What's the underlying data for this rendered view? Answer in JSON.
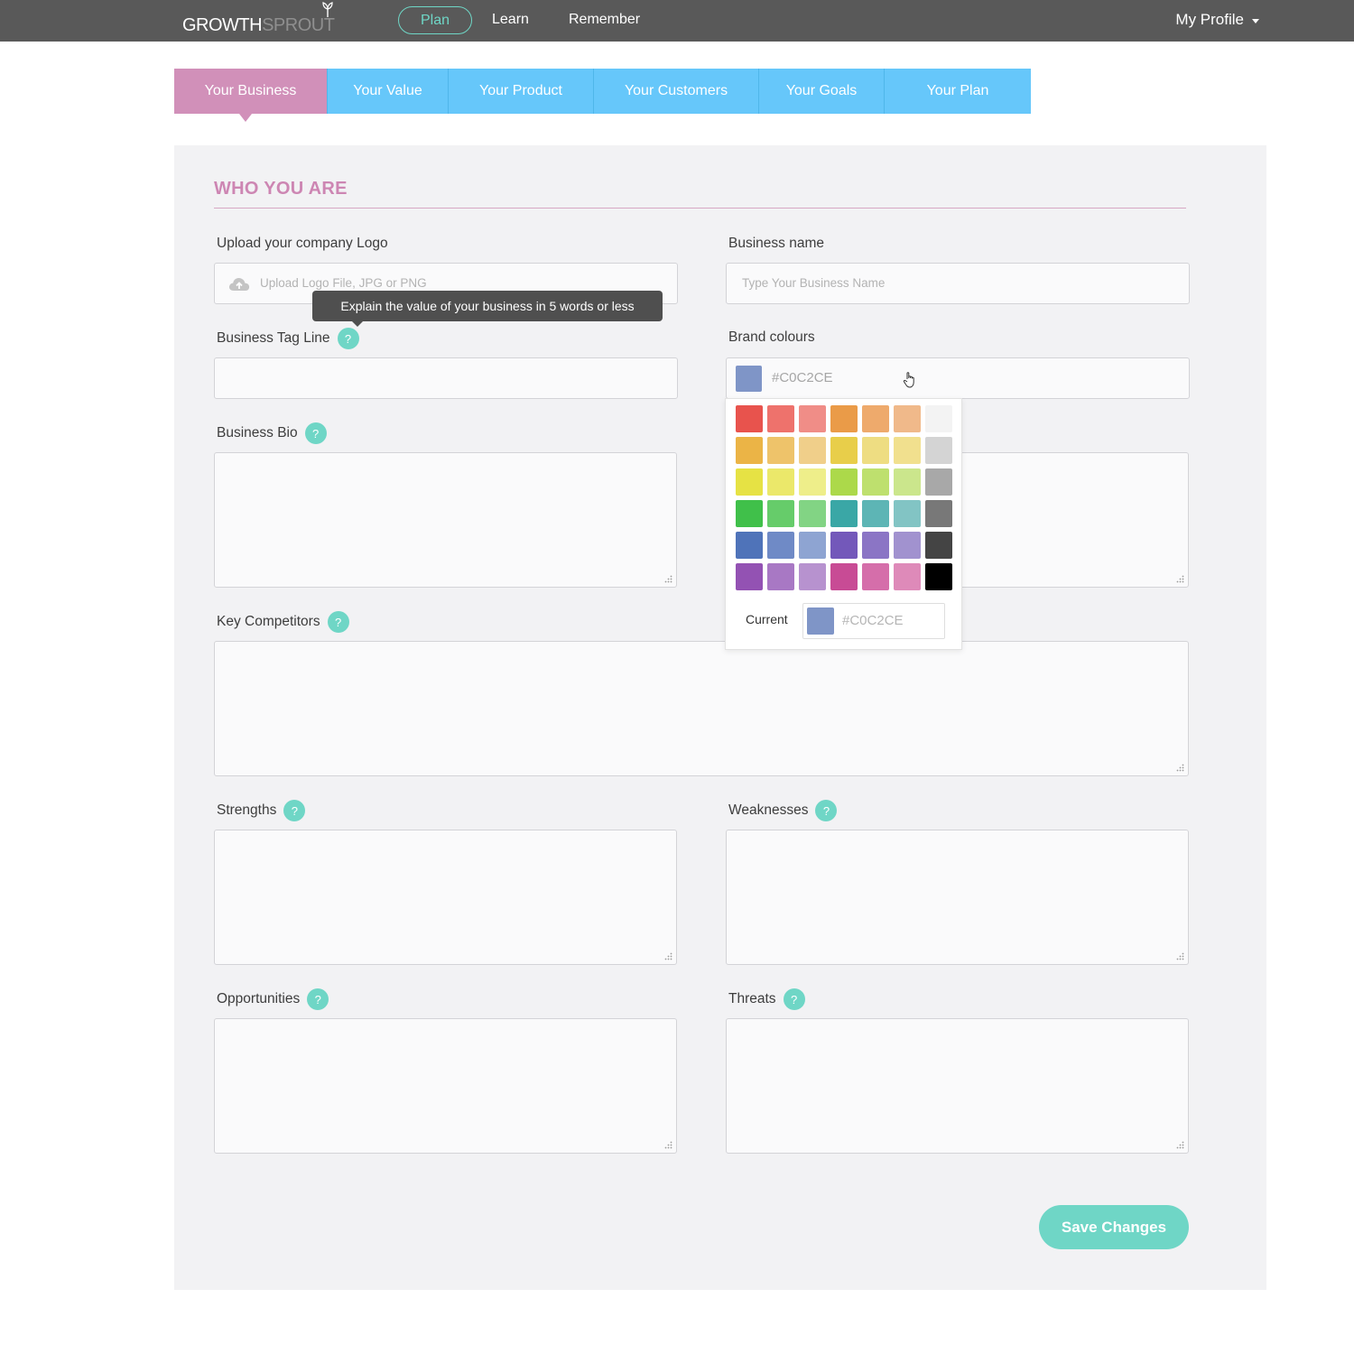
{
  "nav": {
    "logo_growth": "GROWTH",
    "logo_sprout": "SPROUT",
    "plan": "Plan",
    "learn": "Learn",
    "remember": "Remember",
    "profile": "My Profile",
    "accent_color": "#6fd6c6",
    "bar_color": "#595959"
  },
  "tabs": [
    {
      "label": "Your Business",
      "active": true
    },
    {
      "label": "Your Value",
      "active": false
    },
    {
      "label": "Your Product",
      "active": false
    },
    {
      "label": "Your Customers",
      "active": false
    },
    {
      "label": "Your Goals",
      "active": false
    },
    {
      "label": "Your Plan",
      "active": false
    }
  ],
  "tab_colors": {
    "active": "#d190b9",
    "inactive": "#66c7fa"
  },
  "section": {
    "title": "WHO YOU ARE",
    "color": "#cd86b3"
  },
  "fields": {
    "logo": {
      "label": "Upload your company Logo",
      "placeholder": "Upload Logo File, JPG or PNG",
      "icon": "cloud-upload-icon"
    },
    "business_name": {
      "label": "Business name",
      "placeholder": "Type Your Business Name"
    },
    "tag_line": {
      "label": "Business Tag Line",
      "value": ""
    },
    "brand_colours": {
      "label": "Brand colours",
      "value": "#C0C2CE",
      "swatch": "#7f95c7"
    },
    "bio": {
      "label": "Business Bio"
    },
    "competitors": {
      "label": "Key Competitors"
    },
    "strengths": {
      "label": "Strengths"
    },
    "weaknesses": {
      "label": "Weaknesses"
    },
    "opportunities": {
      "label": "Opportunities"
    },
    "threats": {
      "label": "Threats"
    }
  },
  "help_glyph": "?",
  "tooltip": "Explain the value of your business in 5 words or less",
  "picker": {
    "colors": [
      "#e8534d",
      "#ee726c",
      "#f08d87",
      "#ea9b48",
      "#eeaa6c",
      "#f0b98a",
      "#f3f3f3",
      "#ebb446",
      "#eec36a",
      "#f0cf8a",
      "#e8ce4a",
      "#eedd82",
      "#f1e08e",
      "#d4d4d4",
      "#e6e244",
      "#ebe86a",
      "#eeee8a",
      "#acd94a",
      "#bee06e",
      "#cbe68c",
      "#a8a8a8",
      "#40c04a",
      "#66cc6a",
      "#82d484",
      "#3aa7a6",
      "#5db5b5",
      "#82c4c4",
      "#787878",
      "#4f73b9",
      "#6f8ac6",
      "#8ea4d2",
      "#7358ba",
      "#8b75c5",
      "#a192cf",
      "#444444",
      "#9352b3",
      "#a878c4",
      "#b792cf",
      "#c84b95",
      "#d56eaa",
      "#de8ab9",
      "#000000"
    ],
    "current_label": "Current",
    "current_value": "#C0C2CE",
    "current_swatch": "#7f95c7"
  },
  "save_label": "Save Changes"
}
